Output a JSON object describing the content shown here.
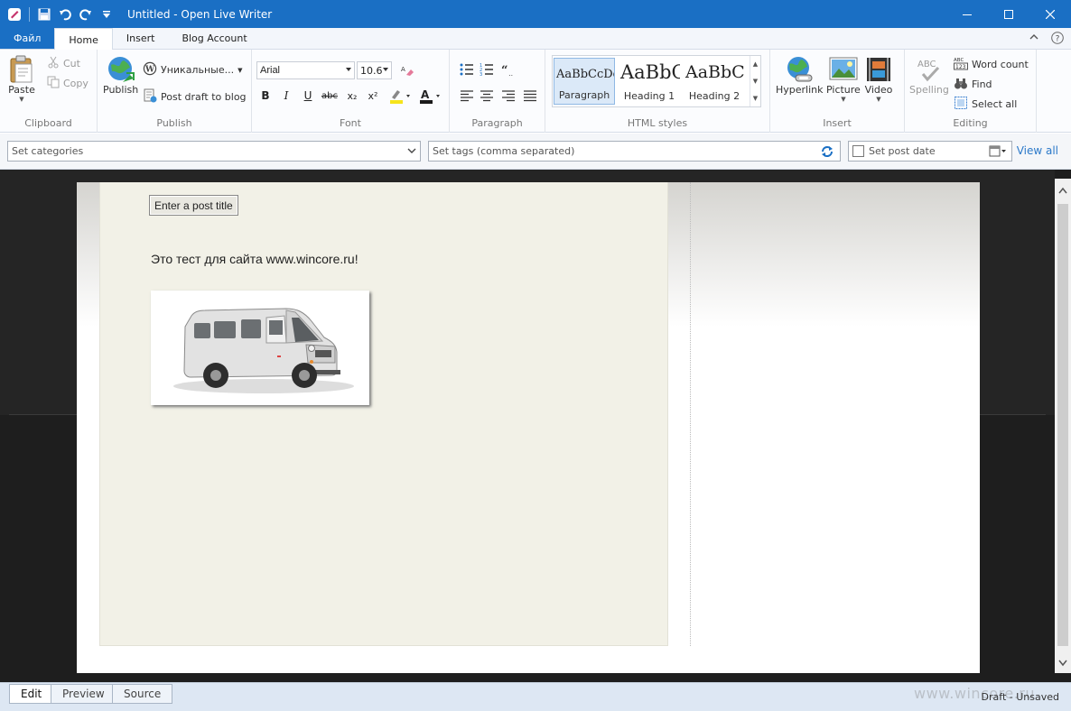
{
  "window": {
    "title": "Untitled - Open Live Writer"
  },
  "tabs": {
    "file": "Файл",
    "home": "Home",
    "insert": "Insert",
    "blog_account": "Blog Account"
  },
  "ribbon": {
    "clipboard": {
      "label": "Clipboard",
      "paste": "Paste",
      "cut": "Cut",
      "copy": "Copy"
    },
    "publish": {
      "label": "Publish",
      "publish": "Publish",
      "account": "Уникальные...",
      "post_draft": "Post draft to blog"
    },
    "font": {
      "label": "Font",
      "family": "Arial",
      "size": "10.6",
      "bold": "B",
      "italic": "I",
      "underline": "U",
      "strike": "abc",
      "subscript": "x₂",
      "superscript": "x²",
      "highlight_color": "#f6e41b",
      "text_color": "#1a1a1a"
    },
    "paragraph": {
      "label": "Paragraph"
    },
    "html_styles": {
      "label": "HTML styles",
      "items": [
        {
          "sample": "AaBbCcDd",
          "name": "Paragraph"
        },
        {
          "sample": "AaBbC",
          "name": "Heading 1"
        },
        {
          "sample": "AaBbCc",
          "name": "Heading 2"
        }
      ]
    },
    "insert": {
      "label": "Insert",
      "hyperlink": "Hyperlink",
      "picture": "Picture",
      "video": "Video"
    },
    "editing": {
      "label": "Editing",
      "spelling": "Spelling",
      "word_count": "Word count",
      "find": "Find",
      "select_all": "Select all"
    }
  },
  "meta": {
    "categories_placeholder": "Set categories",
    "tags_placeholder": "Set tags (comma separated)",
    "post_date": "Set post date",
    "view_all": "View all"
  },
  "editor": {
    "post_title": "Enter a post title",
    "body_text": "Это тест для сайта www.wincore.ru!"
  },
  "view_tabs": {
    "edit": "Edit",
    "preview": "Preview",
    "source": "Source"
  },
  "status": "Draft - Unsaved",
  "watermark": "www.wincore.ru"
}
